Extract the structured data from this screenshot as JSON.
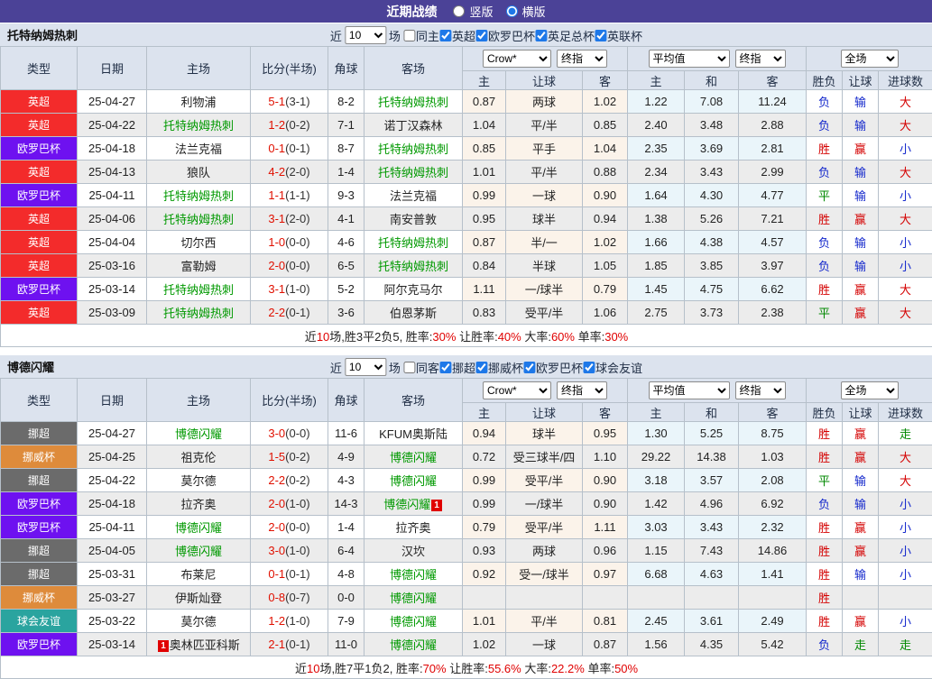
{
  "title_bar": {
    "title": "近期战绩",
    "layout_options": [
      {
        "label": "竖版",
        "selected": false
      },
      {
        "label": "横版",
        "selected": true
      }
    ]
  },
  "colors": {
    "titlebar_bg": "#4b4297",
    "band_bg": "#dce3ee",
    "header_bg": "#dce3ee",
    "header_text": "#223047",
    "border": "#b6c0ca",
    "row_alt": "#ececec",
    "crow_col_bg": "#fbf3ea",
    "avg_col_bg": "#eaf5fa",
    "focal_team": "#009900",
    "score_red": "#e01000",
    "text_dark": "#222222",
    "summary_red": "#e00000",
    "result_red": "#d40000",
    "result_blue": "#1428cc",
    "result_green": "#008800",
    "checkbox_accent": "#1e78e8",
    "league_colors": {
      "英超": "#f32b2b",
      "欧罗巴杯": "#6e11f0",
      "挪超": "#6b6b6b",
      "挪威杯": "#de8b3b",
      "球会友谊": "#2aa49f"
    },
    "result_colors": {
      "胜": "red",
      "负": "blue",
      "平": "green",
      "赢": "red",
      "输": "blue",
      "走": "green",
      "大": "red",
      "小": "blue"
    }
  },
  "filter_labels": {
    "near": "近",
    "count": "10",
    "field": "场"
  },
  "column_headers": {
    "type": "类型",
    "date": "日期",
    "home": "主场",
    "score": "比分(半场)",
    "corner": "角球",
    "away": "客场",
    "sub": [
      "主",
      "让球",
      "客",
      "主",
      "和",
      "客",
      "胜负",
      "让球",
      "进球数"
    ],
    "selects": {
      "crow": "Crow*",
      "final": "终指",
      "avg": "平均值",
      "final2": "终指",
      "full": "全场"
    }
  },
  "tables": [
    {
      "team": "托特纳姆热刺",
      "same_label": "同主",
      "same_checked": false,
      "leagues": [
        "英超",
        "欧罗巴杯",
        "英足总杯",
        "英联杯"
      ],
      "rows": [
        {
          "league": "英超",
          "date": "25-04-27",
          "home": "利物浦",
          "ft": "5-1",
          "ht": "(3-1)",
          "corner": "8-2",
          "away": "托特纳姆热刺",
          "away_focal": true,
          "crow": [
            "0.87",
            "两球",
            "1.02"
          ],
          "avg": [
            "1.22",
            "7.08",
            "11.24"
          ],
          "res": [
            "负",
            "输",
            "大"
          ]
        },
        {
          "league": "英超",
          "date": "25-04-22",
          "home": "托特纳姆热刺",
          "home_focal": true,
          "ft": "1-2",
          "ht": "(0-2)",
          "corner": "7-1",
          "away": "诺丁汉森林",
          "crow": [
            "1.04",
            "平/半",
            "0.85"
          ],
          "avg": [
            "2.40",
            "3.48",
            "2.88"
          ],
          "res": [
            "负",
            "输",
            "大"
          ]
        },
        {
          "league": "欧罗巴杯",
          "date": "25-04-18",
          "home": "法兰克福",
          "ft": "0-1",
          "ht": "(0-1)",
          "corner": "8-7",
          "away": "托特纳姆热刺",
          "away_focal": true,
          "crow": [
            "0.85",
            "平手",
            "1.04"
          ],
          "avg": [
            "2.35",
            "3.69",
            "2.81"
          ],
          "res": [
            "胜",
            "赢",
            "小"
          ]
        },
        {
          "league": "英超",
          "date": "25-04-13",
          "home": "狼队",
          "ft": "4-2",
          "ht": "(2-0)",
          "corner": "1-4",
          "away": "托特纳姆热刺",
          "away_focal": true,
          "crow": [
            "1.01",
            "平/半",
            "0.88"
          ],
          "avg": [
            "2.34",
            "3.43",
            "2.99"
          ],
          "res": [
            "负",
            "输",
            "大"
          ]
        },
        {
          "league": "欧罗巴杯",
          "date": "25-04-11",
          "home": "托特纳姆热刺",
          "home_focal": true,
          "ft": "1-1",
          "ht": "(1-1)",
          "corner": "9-3",
          "away": "法兰克福",
          "crow": [
            "0.99",
            "一球",
            "0.90"
          ],
          "avg": [
            "1.64",
            "4.30",
            "4.77"
          ],
          "res": [
            "平",
            "输",
            "小"
          ]
        },
        {
          "league": "英超",
          "date": "25-04-06",
          "home": "托特纳姆热刺",
          "home_focal": true,
          "ft": "3-1",
          "ht": "(2-0)",
          "corner": "4-1",
          "away": "南安普敦",
          "crow": [
            "0.95",
            "球半",
            "0.94"
          ],
          "avg": [
            "1.38",
            "5.26",
            "7.21"
          ],
          "res": [
            "胜",
            "赢",
            "大"
          ]
        },
        {
          "league": "英超",
          "date": "25-04-04",
          "home": "切尔西",
          "ft": "1-0",
          "ht": "(0-0)",
          "corner": "4-6",
          "away": "托特纳姆热刺",
          "away_focal": true,
          "crow": [
            "0.87",
            "半/一",
            "1.02"
          ],
          "avg": [
            "1.66",
            "4.38",
            "4.57"
          ],
          "res": [
            "负",
            "输",
            "小"
          ]
        },
        {
          "league": "英超",
          "date": "25-03-16",
          "home": "富勒姆",
          "ft": "2-0",
          "ht": "(0-0)",
          "corner": "6-5",
          "away": "托特纳姆热刺",
          "away_focal": true,
          "crow": [
            "0.84",
            "半球",
            "1.05"
          ],
          "avg": [
            "1.85",
            "3.85",
            "3.97"
          ],
          "res": [
            "负",
            "输",
            "小"
          ]
        },
        {
          "league": "欧罗巴杯",
          "date": "25-03-14",
          "home": "托特纳姆热刺",
          "home_focal": true,
          "ft": "3-1",
          "ht": "(1-0)",
          "corner": "5-2",
          "away": "阿尔克马尔",
          "crow": [
            "1.11",
            "一/球半",
            "0.79"
          ],
          "avg": [
            "1.45",
            "4.75",
            "6.62"
          ],
          "res": [
            "胜",
            "赢",
            "大"
          ]
        },
        {
          "league": "英超",
          "date": "25-03-09",
          "home": "托特纳姆热刺",
          "home_focal": true,
          "ft": "2-2",
          "ht": "(0-1)",
          "corner": "3-6",
          "away": "伯恩茅斯",
          "crow": [
            "0.83",
            "受平/半",
            "1.06"
          ],
          "avg": [
            "2.75",
            "3.73",
            "2.38"
          ],
          "res": [
            "平",
            "赢",
            "大"
          ]
        }
      ],
      "summary": [
        {
          "t": "近"
        },
        {
          "t": "10",
          "red": true
        },
        {
          "t": "场,胜3平2负5, 胜率:"
        },
        {
          "t": "30%",
          "red": true
        },
        {
          "t": " 让胜率:"
        },
        {
          "t": "40%",
          "red": true
        },
        {
          "t": " 大率:"
        },
        {
          "t": "60%",
          "red": true
        },
        {
          "t": " 单率:"
        },
        {
          "t": "30%",
          "red": true
        }
      ]
    },
    {
      "team": "博德闪耀",
      "same_label": "同客",
      "same_checked": false,
      "leagues": [
        "挪超",
        "挪威杯",
        "欧罗巴杯",
        "球会友谊"
      ],
      "rows": [
        {
          "league": "挪超",
          "date": "25-04-27",
          "home": "博德闪耀",
          "home_focal": true,
          "ft": "3-0",
          "ht": "(0-0)",
          "corner": "11-6",
          "away": "KFUM奥斯陆",
          "crow": [
            "0.94",
            "球半",
            "0.95"
          ],
          "avg": [
            "1.30",
            "5.25",
            "8.75"
          ],
          "res": [
            "胜",
            "赢",
            "走"
          ]
        },
        {
          "league": "挪威杯",
          "date": "25-04-25",
          "home": "祖克伦",
          "ft": "1-5",
          "ht": "(0-2)",
          "corner": "4-9",
          "away": "博德闪耀",
          "away_focal": true,
          "crow": [
            "0.72",
            "受三球半/四",
            "1.10"
          ],
          "avg": [
            "29.22",
            "14.38",
            "1.03"
          ],
          "res": [
            "胜",
            "赢",
            "大"
          ]
        },
        {
          "league": "挪超",
          "date": "25-04-22",
          "home": "莫尔德",
          "ft": "2-2",
          "ht": "(0-2)",
          "corner": "4-3",
          "away": "博德闪耀",
          "away_focal": true,
          "crow": [
            "0.99",
            "受平/半",
            "0.90"
          ],
          "avg": [
            "3.18",
            "3.57",
            "2.08"
          ],
          "res": [
            "平",
            "输",
            "大"
          ]
        },
        {
          "league": "欧罗巴杯",
          "date": "25-04-18",
          "home": "拉齐奥",
          "ft": "2-0",
          "ht": "(1-0)",
          "corner": "14-3",
          "away": "博德闪耀",
          "away_focal": true,
          "away_card_post": "1",
          "crow": [
            "0.99",
            "一/球半",
            "0.90"
          ],
          "avg": [
            "1.42",
            "4.96",
            "6.92"
          ],
          "res": [
            "负",
            "输",
            "小"
          ]
        },
        {
          "league": "欧罗巴杯",
          "date": "25-04-11",
          "home": "博德闪耀",
          "home_focal": true,
          "ft": "2-0",
          "ht": "(0-0)",
          "corner": "1-4",
          "away": "拉齐奥",
          "crow": [
            "0.79",
            "受平/半",
            "1.11"
          ],
          "avg": [
            "3.03",
            "3.43",
            "2.32"
          ],
          "res": [
            "胜",
            "赢",
            "小"
          ]
        },
        {
          "league": "挪超",
          "date": "25-04-05",
          "home": "博德闪耀",
          "home_focal": true,
          "ft": "3-0",
          "ht": "(1-0)",
          "corner": "6-4",
          "away": "汉坎",
          "crow": [
            "0.93",
            "两球",
            "0.96"
          ],
          "avg": [
            "1.15",
            "7.43",
            "14.86"
          ],
          "res": [
            "胜",
            "赢",
            "小"
          ]
        },
        {
          "league": "挪超",
          "date": "25-03-31",
          "home": "布莱尼",
          "ft": "0-1",
          "ht": "(0-1)",
          "corner": "4-8",
          "away": "博德闪耀",
          "away_focal": true,
          "crow": [
            "0.92",
            "受一/球半",
            "0.97"
          ],
          "avg": [
            "6.68",
            "4.63",
            "1.41"
          ],
          "res": [
            "胜",
            "输",
            "小"
          ]
        },
        {
          "league": "挪威杯",
          "date": "25-03-27",
          "home": "伊斯灿登",
          "ft": "0-8",
          "ht": "(0-7)",
          "corner": "0-0",
          "away": "博德闪耀",
          "away_focal": true,
          "crow": [
            "",
            "",
            ""
          ],
          "avg": [
            "",
            "",
            ""
          ],
          "res": [
            "胜",
            "",
            ""
          ]
        },
        {
          "league": "球会友谊",
          "date": "25-03-22",
          "home": "莫尔德",
          "ft": "1-2",
          "ht": "(1-0)",
          "corner": "7-9",
          "away": "博德闪耀",
          "away_focal": true,
          "crow": [
            "1.01",
            "平/半",
            "0.81"
          ],
          "avg": [
            "2.45",
            "3.61",
            "2.49"
          ],
          "res": [
            "胜",
            "赢",
            "小"
          ]
        },
        {
          "league": "欧罗巴杯",
          "date": "25-03-14",
          "home": "奥林匹亚科斯",
          "home_card_pre": "1",
          "ft": "2-1",
          "ht": "(0-1)",
          "corner": "11-0",
          "away": "博德闪耀",
          "away_focal": true,
          "crow": [
            "1.02",
            "一球",
            "0.87"
          ],
          "avg": [
            "1.56",
            "4.35",
            "5.42"
          ],
          "res": [
            "负",
            "走",
            "走"
          ]
        }
      ],
      "summary": [
        {
          "t": "近"
        },
        {
          "t": "10",
          "red": true
        },
        {
          "t": "场,胜7平1负2, 胜率:"
        },
        {
          "t": "70%",
          "red": true
        },
        {
          "t": " 让胜率:"
        },
        {
          "t": "55.6%",
          "red": true
        },
        {
          "t": " 大率:"
        },
        {
          "t": "22.2%",
          "red": true
        },
        {
          "t": " 单率:"
        },
        {
          "t": "50%",
          "red": true
        }
      ]
    }
  ]
}
